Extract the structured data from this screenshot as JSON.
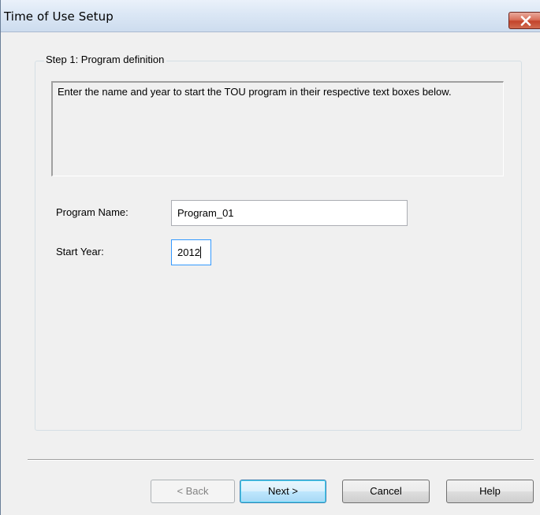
{
  "window": {
    "title": "Time of Use Setup"
  },
  "group": {
    "legend": "Step 1: Program definition",
    "description": "Enter the name and year to start the TOU program in their respective text boxes below."
  },
  "form": {
    "program_name_label": "Program Name:",
    "program_name_value": "Program_01",
    "start_year_label": "Start Year:",
    "start_year_value": "2012"
  },
  "buttons": {
    "back": "< Back",
    "next": "Next >",
    "cancel": "Cancel",
    "help": "Help"
  },
  "icons": {
    "close": "close-icon"
  },
  "colors": {
    "titlebar": "#dbe7f5",
    "close_button": "#c3442b",
    "focus_border": "#3399ff",
    "default_button": "#3c7fb1"
  }
}
